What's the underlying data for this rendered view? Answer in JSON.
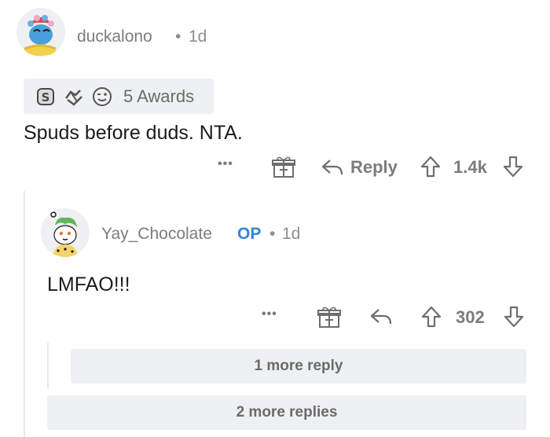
{
  "comment": {
    "username": "duckalono",
    "separator": "•",
    "time": "1d",
    "awards_label": "5 Awards",
    "body": "Spuds before duds. NTA.",
    "actions": {
      "more_label": "•••",
      "reply_label": "Reply",
      "score": "1.4k"
    }
  },
  "reply": {
    "username": "Yay_Chocolate",
    "op_badge": "OP",
    "separator": "•",
    "time": "1d",
    "body": "LMFAO!!!",
    "actions": {
      "more_label": "•••",
      "score": "302"
    },
    "more_reply_label": "1 more reply"
  },
  "more_replies_label": "2 more replies",
  "icons": [
    "award-silver-icon",
    "award-handshake-icon",
    "award-wink-icon",
    "gift-icon",
    "reply-arrow-icon",
    "upvote-icon",
    "downvote-icon"
  ],
  "colors": {
    "op_blue": "#3b82d6",
    "muted": "#7c7c7c",
    "panel": "#eef0f1"
  }
}
